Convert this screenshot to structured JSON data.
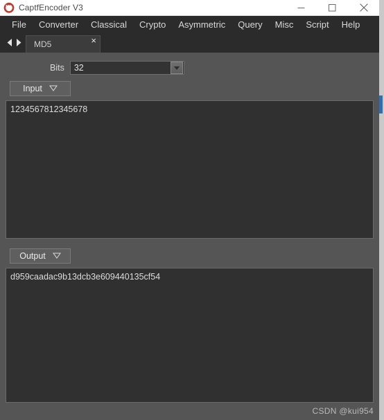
{
  "window": {
    "title": "CaptfEncoder V3",
    "app_icon": "captf-ring-icon",
    "controls": {
      "minimize": "minimize-icon",
      "maximize": "maximize-icon",
      "close": "close-icon"
    }
  },
  "menu": {
    "items": [
      {
        "label": "File"
      },
      {
        "label": "Converter"
      },
      {
        "label": "Classical"
      },
      {
        "label": "Crypto"
      },
      {
        "label": "Asymmetric"
      },
      {
        "label": "Query"
      },
      {
        "label": "Misc"
      },
      {
        "label": "Script"
      },
      {
        "label": "Help"
      }
    ]
  },
  "tabs": {
    "nav_prev": "chevron-left-icon",
    "nav_next": "chevron-right-icon",
    "items": [
      {
        "label": "MD5",
        "close": "×",
        "active": true
      }
    ]
  },
  "form": {
    "bits": {
      "label": "Bits",
      "value": "32",
      "dropdown_icon": "chevron-down-icon",
      "options": [
        "32"
      ]
    }
  },
  "input_section": {
    "button_label": "Input",
    "menu_icon": "triangle-down-icon",
    "value": "1234567812345678",
    "placeholder": ""
  },
  "output_section": {
    "button_label": "Output",
    "menu_icon": "triangle-down-icon",
    "value": "d959caadac9b13dcb3e609440135cf54",
    "placeholder": ""
  },
  "watermark": {
    "text": "CSDN @kui954"
  },
  "colors": {
    "window_background": "#555555",
    "menu_background": "#2b2b2b",
    "tab_active": "#3c3c3c",
    "field_background": "#303030",
    "text_primary": "#dcdcdc",
    "titlebar_background": "#ffffff",
    "accent_icon": "#c0392b",
    "scrollbar_accent": "#2f6fb0"
  }
}
